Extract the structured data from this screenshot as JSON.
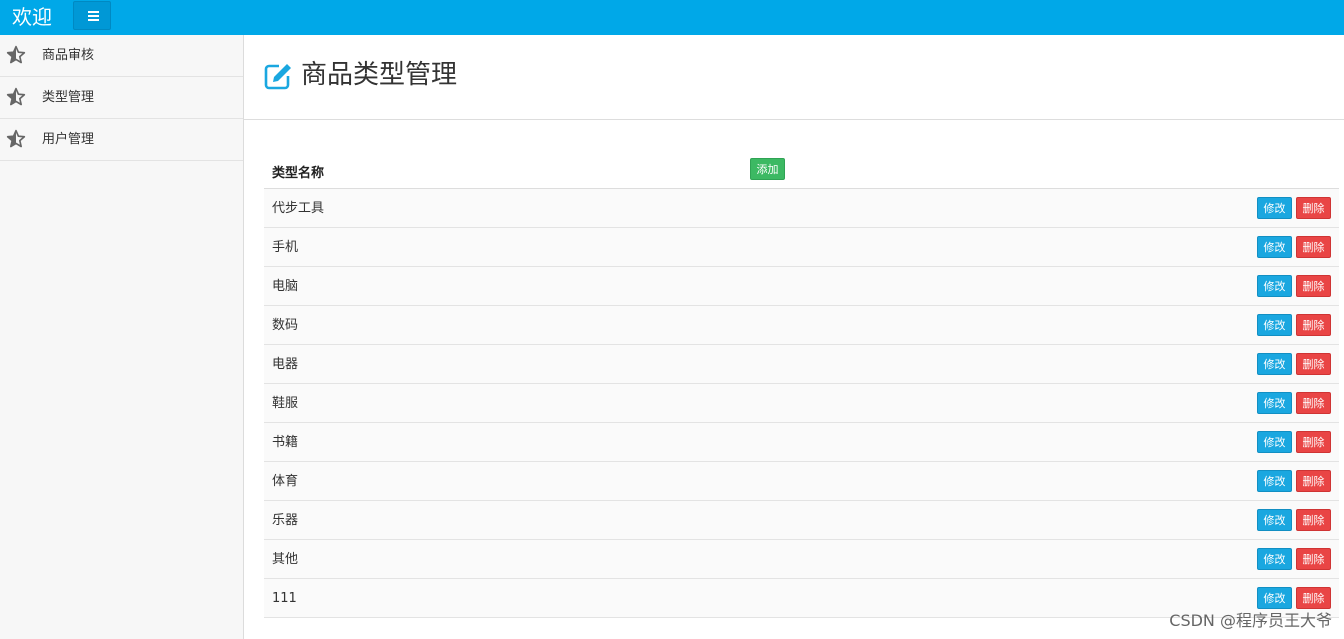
{
  "header": {
    "brand": "欢迎"
  },
  "sidebar": {
    "items": [
      {
        "label": "商品审核"
      },
      {
        "label": "类型管理"
      },
      {
        "label": "用户管理"
      }
    ]
  },
  "main": {
    "title": "商品类型管理",
    "table": {
      "column_name": "类型名称",
      "add_label": "添加",
      "edit_label": "修改",
      "delete_label": "删除",
      "rows": [
        "代步工具",
        "手机",
        "电脑",
        "数码",
        "电器",
        "鞋服",
        "书籍",
        "体育",
        "乐器",
        "其他",
        "111"
      ]
    }
  },
  "watermark": "CSDN @程序员王大爷",
  "colors": {
    "topbar": "#00a8e8",
    "add": "#3cb963",
    "edit": "#1aa7e0",
    "delete": "#e94545"
  }
}
